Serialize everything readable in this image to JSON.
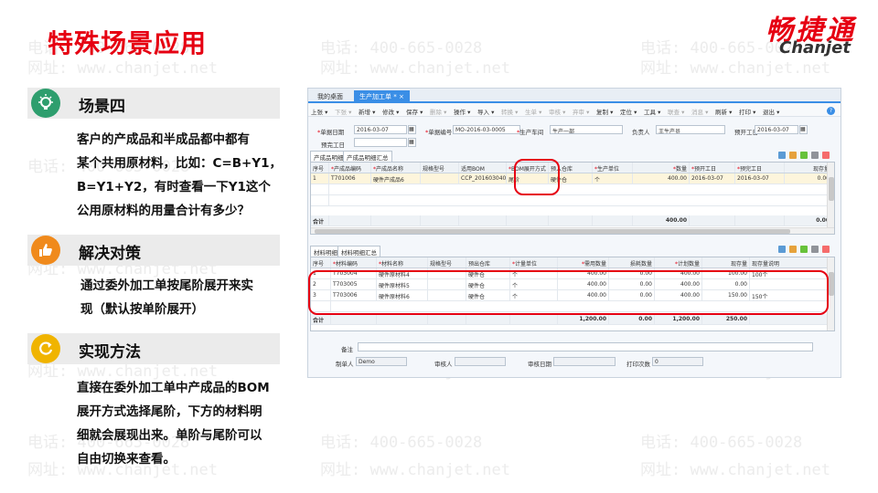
{
  "slide": {
    "title": "特殊场景应用",
    "logo_cn": "畅捷通",
    "logo_en": "Chanjet",
    "watermark_phone": "电话: 400-665-0028",
    "watermark_url": "网址: www.chanjet.net"
  },
  "sections": [
    {
      "label": "场景四",
      "icon": "lightbulb-icon",
      "color": "#2e9e6e",
      "lines": [
        "客户的产成品和半成品都中都有",
        "某个共用原材料，比如：C=B+Y1，",
        "B=Y1+Y2，有时查看一下Y1这个",
        "公用原材料的用量合计有多少？"
      ]
    },
    {
      "label": "解决对策",
      "icon": "thumbs-up-icon",
      "color": "#f08a1c",
      "lines": [
        "通过委外加工单按尾阶展开来实",
        "现（默认按单阶展开）"
      ]
    },
    {
      "label": "实现方法",
      "icon": "refresh-icon",
      "color": "#f0b400",
      "lines": [
        "直接在委外加工单中产成品的BOM",
        "展开方式选择尾阶，下方的材料明",
        "细就会展现出来。单阶与尾阶可以",
        "自由切换来查看。"
      ]
    }
  ],
  "app": {
    "tabs": [
      "我的桌面",
      "生产加工单 *"
    ],
    "toolbar": [
      "上张",
      "下张",
      "新增",
      "修改",
      "保存",
      "删除",
      "操作",
      "导入",
      "转换",
      "生单",
      "审核",
      "弃审",
      "复制",
      "定位",
      "工具",
      "联查",
      "消息",
      "刷新",
      "打印",
      "退出"
    ],
    "toolbar_disabled": [
      false,
      true,
      false,
      false,
      false,
      true,
      false,
      false,
      true,
      true,
      true,
      true,
      false,
      false,
      false,
      true,
      true,
      false,
      false,
      false
    ],
    "fields": {
      "doc_date_label": "单据日期",
      "doc_date": "2016-03-07",
      "doc_no_label": "单据编号",
      "doc_no": "MO-2016-03-0005",
      "workshop_label": "生产车间",
      "workshop": "生产一部",
      "owner_label": "负责人",
      "owner": "王生产员",
      "plan_end_label": "预开工日",
      "plan_end": "2016-03-07",
      "plan_done_label": "预完工日"
    },
    "product_tabs": [
      "产成品明细",
      "产成品明细汇总"
    ],
    "product_headers": [
      "序号",
      "产成品编码",
      "产成品名称",
      "规格型号",
      "适用BOM",
      "BOM展开方式",
      "预入仓库",
      "生产单位",
      "数量",
      "预开工日",
      "预完工日",
      "现存量",
      "现"
    ],
    "product_required": [
      false,
      true,
      true,
      false,
      false,
      true,
      false,
      true,
      true,
      true,
      true,
      false,
      false
    ],
    "product_rows": [
      [
        "1",
        "T701006",
        "硬件产成品6",
        "",
        "CCP_20160304009",
        "尾阶",
        "硬件仓",
        "个",
        "400.00",
        "2016-03-07",
        "2016-03-07",
        "0.00",
        ""
      ]
    ],
    "product_total_label": "合计",
    "product_total_qty": "400.00",
    "product_total_stock": "0.00",
    "material_tabs": [
      "材料明细",
      "材料明细汇总"
    ],
    "material_headers": [
      "序号",
      "材料编码",
      "材料名称",
      "规格型号",
      "预出仓库",
      "计量单位",
      "需用数量",
      "损耗数量",
      "计划数量",
      "现存量",
      "现存量说明"
    ],
    "material_required": [
      false,
      true,
      true,
      false,
      false,
      true,
      true,
      false,
      true,
      false,
      false
    ],
    "material_rows": [
      [
        "1",
        "T703004",
        "硬件原材料4",
        "",
        "硬件仓",
        "个",
        "400.00",
        "0.00",
        "400.00",
        "100.00",
        "100个"
      ],
      [
        "2",
        "T703005",
        "硬件原材料5",
        "",
        "硬件仓",
        "个",
        "400.00",
        "0.00",
        "400.00",
        "0.00",
        ""
      ],
      [
        "3",
        "T703006",
        "硬件原材料6",
        "",
        "硬件仓",
        "个",
        "400.00",
        "0.00",
        "400.00",
        "150.00",
        "150个"
      ]
    ],
    "material_total_label": "合计",
    "material_totals": [
      "1,200.00",
      "0.00",
      "1,200.00",
      "250.00"
    ],
    "footer": {
      "remark_label": "备注",
      "maker_label": "制单人",
      "maker": "Demo",
      "auditor_label": "审核人",
      "audit_date_label": "审核日期",
      "print_count_label": "打印次数",
      "print_count": "0"
    }
  }
}
